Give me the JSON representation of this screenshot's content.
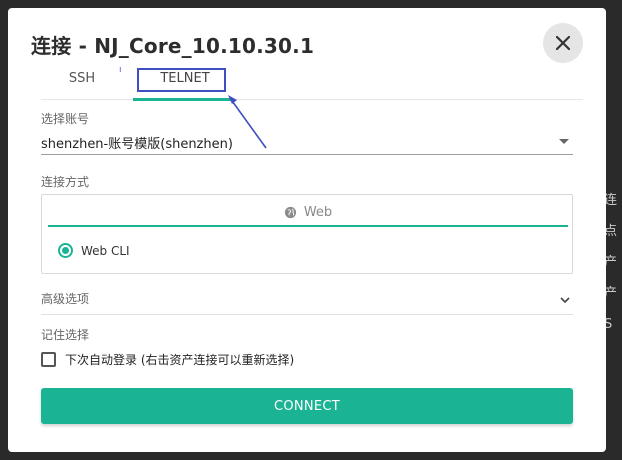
{
  "background": {
    "snippets": [
      "连",
      "点",
      "产",
      "产",
      "S"
    ]
  },
  "dialog": {
    "title": "连接 - NJ_Core_10.10.30.1",
    "close_icon": "close-icon",
    "tabs": [
      {
        "label": "SSH",
        "active": false
      },
      {
        "label": "TELNET",
        "active": true
      }
    ],
    "account": {
      "label": "选择账号",
      "value": "shenzhen-账号模版(shenzhen)"
    },
    "method": {
      "label": "连接方式",
      "tab_label": "Web",
      "tab_icon": "globe-icon",
      "option": "Web CLI",
      "option_selected": true
    },
    "advanced": {
      "label": "高级选项"
    },
    "remember": {
      "label": "记住选择",
      "checkbox_label": "下次自动登录 (右击资产连接可以重新选择)",
      "checked": false
    },
    "connect_label": "CONNECT"
  },
  "colors": {
    "accent": "#1ab394",
    "annotation": "#3f4fbf"
  }
}
